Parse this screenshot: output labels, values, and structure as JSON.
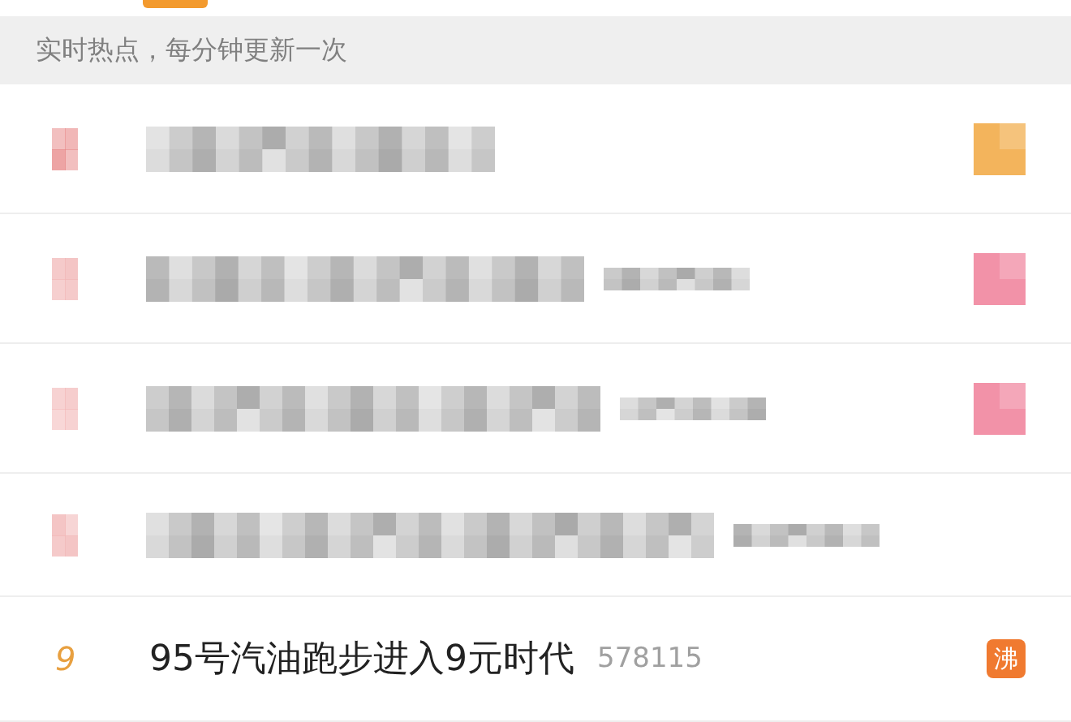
{
  "top_tab": {
    "selected": true
  },
  "notice": "实时热点，每分钟更新一次",
  "rows": [
    {
      "kind": "blurred",
      "color": "#f3b45c",
      "has_count": false
    },
    {
      "kind": "blurred",
      "color": "#f292a8",
      "has_count": true
    },
    {
      "kind": "blurred",
      "color": "#f292a8",
      "has_count": true
    },
    {
      "kind": "blurred",
      "has_count": true
    },
    {
      "kind": "entry",
      "rank": "9",
      "title": "95号汽油跑步进入9元时代",
      "count": "578115",
      "badge": "沸",
      "color": "#f07a30"
    }
  ]
}
